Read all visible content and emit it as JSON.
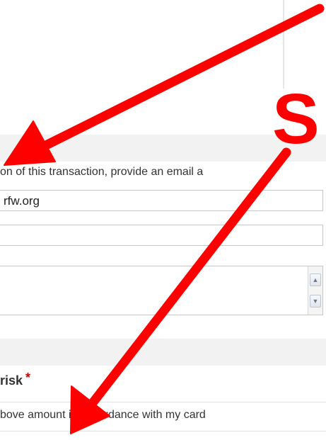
{
  "colors": {
    "annotation_red": "#ff0000",
    "required_red": "#cc0000",
    "section_band": "#f2f2f2"
  },
  "annotation": {
    "letter": "S"
  },
  "form": {
    "instruction": "on of this transaction, provide an email a",
    "email_value": "rfw.org",
    "phone_value": "",
    "comments_value": "",
    "risk_label": "risk",
    "required_mark": "*",
    "consent_text": "bove amount in accordance with my card"
  },
  "icons": {
    "scroll_up": "scroll-up-arrow-icon",
    "scroll_down": "scroll-down-arrow-icon"
  }
}
